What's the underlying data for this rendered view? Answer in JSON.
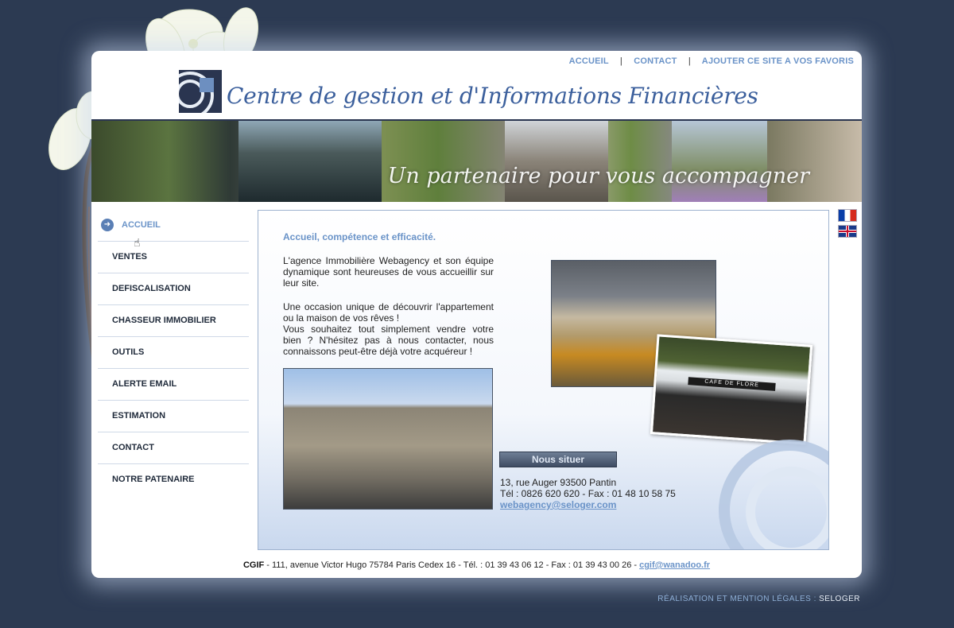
{
  "topnav": {
    "accueil": "ACCUEIL",
    "contact": "CONTACT",
    "favoris": "AJOUTER CE SITE A VOS FAVORIS",
    "separator": "|"
  },
  "header": {
    "title": "Centre de gestion et d'Informations Financières",
    "tagline": "Un partenaire pour vous accompagner"
  },
  "sidebar": {
    "items": [
      {
        "label": "ACCUEIL"
      },
      {
        "label": "VENTES"
      },
      {
        "label": "DEFISCALISATION"
      },
      {
        "label": "CHASSEUR IMMOBILIER"
      },
      {
        "label": "OUTILS"
      },
      {
        "label": "ALERTE EMAIL"
      },
      {
        "label": "ESTIMATION"
      },
      {
        "label": "CONTACT"
      },
      {
        "label": "NOTRE PATENAIRE"
      }
    ]
  },
  "content": {
    "heading": "Accueil, compétence et efficacité.",
    "para1": "L'agence Immobilière Webagency et son équipe dynamique sont heureuses de vous accueillir sur leur site.",
    "para2": "Une occasion unique de découvrir l'appartement ou la maison de vos rêves !",
    "para3": "Vous souhaitez tout simplement vendre votre bien ? N'hésitez pas à nous contacter, nous connaissons peut-être déjà votre acquéreur !",
    "cafe_sign": "CAFE DE FLORE",
    "locate_button": "Nous situer",
    "address": "13, rue Auger 93500 Pantin",
    "phone": "Tél : 0826 620 620 - Fax : 01 48 10 58 75",
    "email": "webagency@seloger.com"
  },
  "footer": {
    "company": "CGIF",
    "address": " - 111, avenue Victor Hugo 75784 Paris Cedex 16 - Tél. : 01 39 43 06 12 - Fax : 01 39 43 00 26 - ",
    "email": "cgif@wanadoo.fr"
  },
  "credits": {
    "text": "RÉALISATION ET MENTION LÉGALES : ",
    "brand": "SELOGER"
  },
  "colors": {
    "background": "#2c3a52",
    "accent": "#6a93c8",
    "title": "#3b5f9c"
  }
}
